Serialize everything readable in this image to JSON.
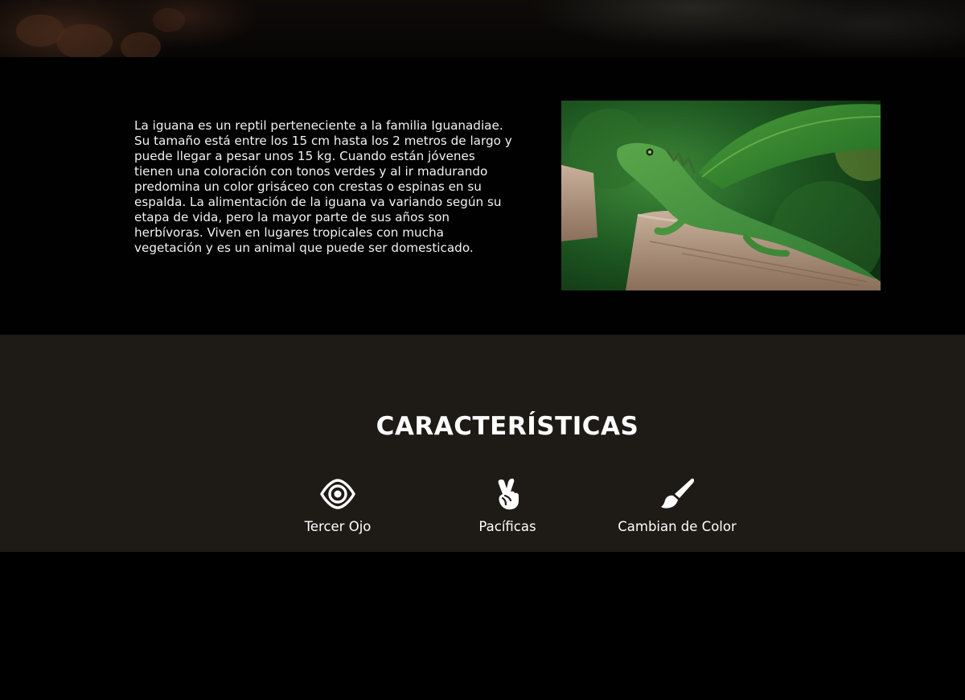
{
  "intro": {
    "description": "La iguana es un reptil perteneciente a la familia Iguanadiae. Su tamaño está entre los 15 cm hasta los 2 metros de largo y puede llegar a pesar unos 15 kg. Cuando están jóvenes tienen una coloración con tonos verdes y al ir madurando predomina un color grisáceo con crestas o espinas en su espalda. La alimentación de la iguana va variando según su etapa de vida, pero la mayor parte de sus años son herbívoras. Viven en lugares tropicales con mucha vegetación y es un animal que puede ser domesticado."
  },
  "features": {
    "title": "CARACTERÍSTICAS",
    "items": [
      {
        "label": "Tercer Ojo",
        "icon": "eye-icon"
      },
      {
        "label": "Pacíficas",
        "icon": "peace-hand-icon"
      },
      {
        "label": "Cambian de Color",
        "icon": "paint-brush-icon"
      }
    ]
  },
  "colors": {
    "page_background": "#010101",
    "features_background": "#1e1a16",
    "text": "#f2f2f2"
  }
}
